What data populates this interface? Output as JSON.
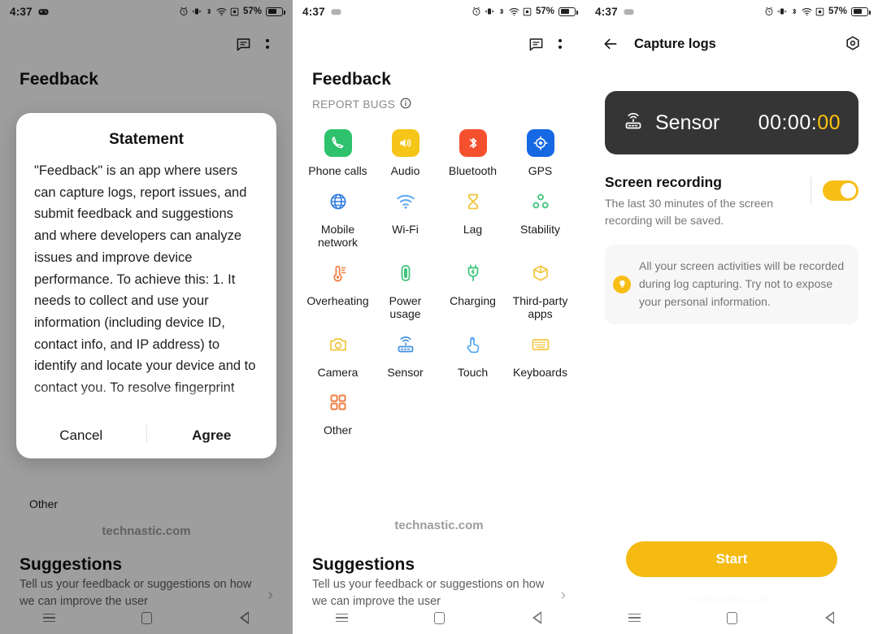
{
  "statusbar": {
    "time": "4:37",
    "battery_percent": "57%",
    "icons": [
      "game-controller-icon",
      "alarm-clock-icon",
      "vibrate-icon",
      "bluetooth-icon",
      "wifi-icon",
      "screenshot-icon"
    ]
  },
  "panel1": {
    "app_title": "Feedback",
    "appbar_icons": [
      "chat-icon",
      "overflow-menu-icon"
    ],
    "behind_label": "Other",
    "watermark": "technastic.com",
    "suggestions_title": "Suggestions",
    "suggestions_text": "Tell us your feedback or suggestions on how we can improve the user",
    "dialog": {
      "title": "Statement",
      "body": "\"Feedback\" is an app where users can capture logs, report issues, and submit feedback and suggestions and where developers can analyze issues and improve device performance. To achieve this:\n1. It needs to collect and use your information (including device ID, contact info, and IP address) to identify and locate your device and to contact you. To resolve fingerprint",
      "cancel_label": "Cancel",
      "agree_label": "Agree"
    }
  },
  "panel2": {
    "app_title": "Feedback",
    "section_label": "REPORT BUGS",
    "info_icon": "info-icon",
    "items": [
      {
        "label": "Phone calls",
        "icon": "phone-icon",
        "style": "filled",
        "color": "#2DC26B"
      },
      {
        "label": "Audio",
        "icon": "volume-icon",
        "style": "filled",
        "color": "#F5C518"
      },
      {
        "label": "Bluetooth",
        "icon": "bluetooth-icon",
        "style": "filled",
        "color": "#F4502E"
      },
      {
        "label": "GPS",
        "icon": "gps-icon",
        "style": "filled",
        "color": "#1668E3"
      },
      {
        "label": "Mobile network",
        "icon": "globe-icon",
        "style": "outline",
        "color": "#2F7BE0"
      },
      {
        "label": "Wi-Fi",
        "icon": "wifi-icon",
        "style": "outline",
        "color": "#59A8F5"
      },
      {
        "label": "Lag",
        "icon": "hourglass-icon",
        "style": "outline",
        "color": "#F2C53D"
      },
      {
        "label": "Stability",
        "icon": "nodes-icon",
        "style": "outline",
        "color": "#3FC47C"
      },
      {
        "label": "Overheating",
        "icon": "thermometer-icon",
        "style": "outline",
        "color": "#F07B3F"
      },
      {
        "label": "Power usage",
        "icon": "battery-icon",
        "style": "outline",
        "color": "#3FC47C"
      },
      {
        "label": "Charging",
        "icon": "plug-icon",
        "style": "outline",
        "color": "#3FC47C"
      },
      {
        "label": "Third-party apps",
        "icon": "box-icon",
        "style": "outline",
        "color": "#F2C53D"
      },
      {
        "label": "Camera",
        "icon": "camera-icon",
        "style": "outline",
        "color": "#F2C53D"
      },
      {
        "label": "Sensor",
        "icon": "sensor-icon",
        "style": "outline",
        "color": "#3F8FE0"
      },
      {
        "label": "Touch",
        "icon": "touch-icon",
        "style": "outline",
        "color": "#59A8F5"
      },
      {
        "label": "Keyboards",
        "icon": "keyboard-icon",
        "style": "outline",
        "color": "#F2C53D"
      },
      {
        "label": "Other",
        "icon": "grid-icon",
        "style": "outline",
        "color": "#F07B3F"
      }
    ],
    "watermark": "technastic.com",
    "suggestions_title": "Suggestions",
    "suggestions_text": "Tell us your feedback or suggestions on how we can improve the user"
  },
  "panel3": {
    "title": "Capture logs",
    "back_icon": "back-arrow-icon",
    "settings_icon": "gear-icon",
    "timer": {
      "icon": "sensor-icon",
      "name": "Sensor",
      "value_plain": "00:00:",
      "value_highlight": "00",
      "highlight_color": "#FFC20E"
    },
    "screen_recording": {
      "title": "Screen recording",
      "subtitle": "The last 30 minutes of the screen recording will be saved.",
      "toggle_on": true,
      "toggle_color": "#F7BE16"
    },
    "tip": {
      "icon": "lightbulb-icon",
      "text": "All your screen activities will be recorded during log capturing. Try not to expose your personal information."
    },
    "start_label": "Start",
    "watermark": "technastic.com"
  },
  "navbar": {
    "buttons": [
      "recents-icon",
      "home-icon",
      "back-icon"
    ]
  }
}
